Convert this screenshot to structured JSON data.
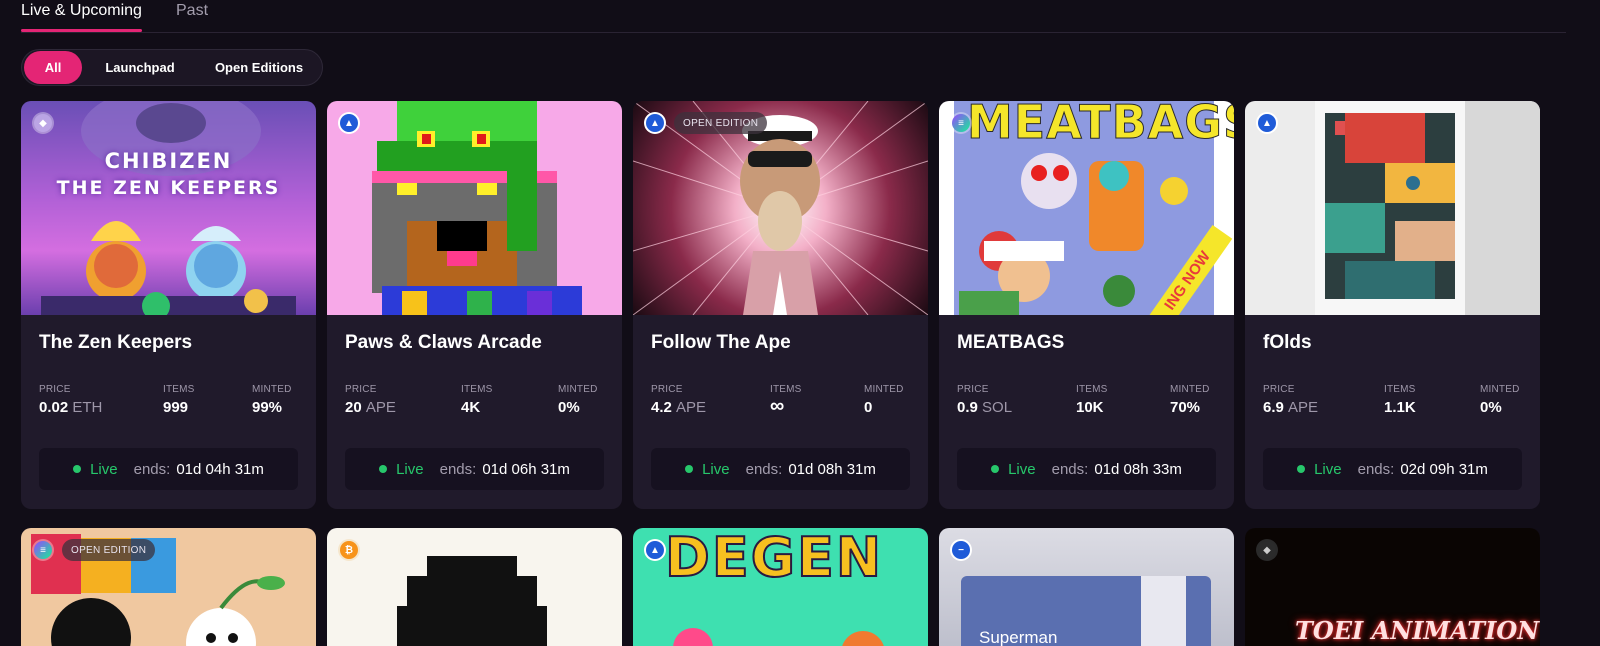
{
  "tabs": [
    {
      "label": "Live & Upcoming",
      "active": true
    },
    {
      "label": "Past",
      "active": false
    }
  ],
  "filters": [
    {
      "label": "All",
      "active": true
    },
    {
      "label": "Launchpad",
      "active": false
    },
    {
      "label": "Open Editions",
      "active": false
    }
  ],
  "cards": [
    {
      "title": "The Zen Keepers",
      "chain_icon": "eth-icon",
      "art_title_line1": "CHIBIZEN",
      "art_title_line2": "THE ZEN KEEPERS",
      "price_label": "PRICE",
      "price": "0.02",
      "currency": "ETH",
      "items_label": "ITEMS",
      "items": "999",
      "minted_label": "MINTED",
      "minted": "99%",
      "status": "Live",
      "ends_label": "ends:",
      "ends": "01d 04h 31m"
    },
    {
      "title": "Paws & Claws Arcade",
      "chain_icon": "apechain-icon",
      "price_label": "PRICE",
      "price": "20",
      "currency": "APE",
      "items_label": "ITEMS",
      "items": "4K",
      "minted_label": "MINTED",
      "minted": "0%",
      "status": "Live",
      "ends_label": "ends:",
      "ends": "01d 06h 31m"
    },
    {
      "title": "Follow The Ape",
      "chain_icon": "apechain-icon",
      "edition_tag": "OPEN EDITION",
      "price_label": "PRICE",
      "price": "4.2",
      "currency": "APE",
      "items_label": "ITEMS",
      "items": "∞",
      "minted_label": "MINTED",
      "minted": "0",
      "status": "Live",
      "ends_label": "ends:",
      "ends": "01d 08h 31m"
    },
    {
      "title": "MEATBAGS",
      "chain_icon": "solana-icon",
      "art_title": "MEATBAGS",
      "art_banner": "ING NOW",
      "price_label": "PRICE",
      "price": "0.9",
      "currency": "SOL",
      "items_label": "ITEMS",
      "items": "10K",
      "minted_label": "MINTED",
      "minted": "70%",
      "status": "Live",
      "ends_label": "ends:",
      "ends": "01d 08h 33m"
    },
    {
      "title": "fOlds",
      "chain_icon": "apechain-icon",
      "price_label": "PRICE",
      "price": "6.9",
      "currency": "APE",
      "items_label": "ITEMS",
      "items": "1.1K",
      "minted_label": "MINTED",
      "minted": "0%",
      "status": "Live",
      "ends_label": "ends:",
      "ends": "02d 09h 31m"
    }
  ],
  "cards_row2": [
    {
      "chain_icon": "solana-icon",
      "edition_tag": "OPEN EDITION"
    },
    {
      "chain_icon": "bitcoin-icon"
    },
    {
      "chain_icon": "apechain-icon",
      "art_title": "DEGEN"
    },
    {
      "chain_icon": "base-icon",
      "art_text": "Superman"
    },
    {
      "chain_icon": "ethereum-icon",
      "art_title": "TOEI ANIMATION"
    }
  ],
  "colors": {
    "accent": "#e42575",
    "live": "#27c76b",
    "card_bg": "#201a2b",
    "page_bg": "#110d17"
  }
}
